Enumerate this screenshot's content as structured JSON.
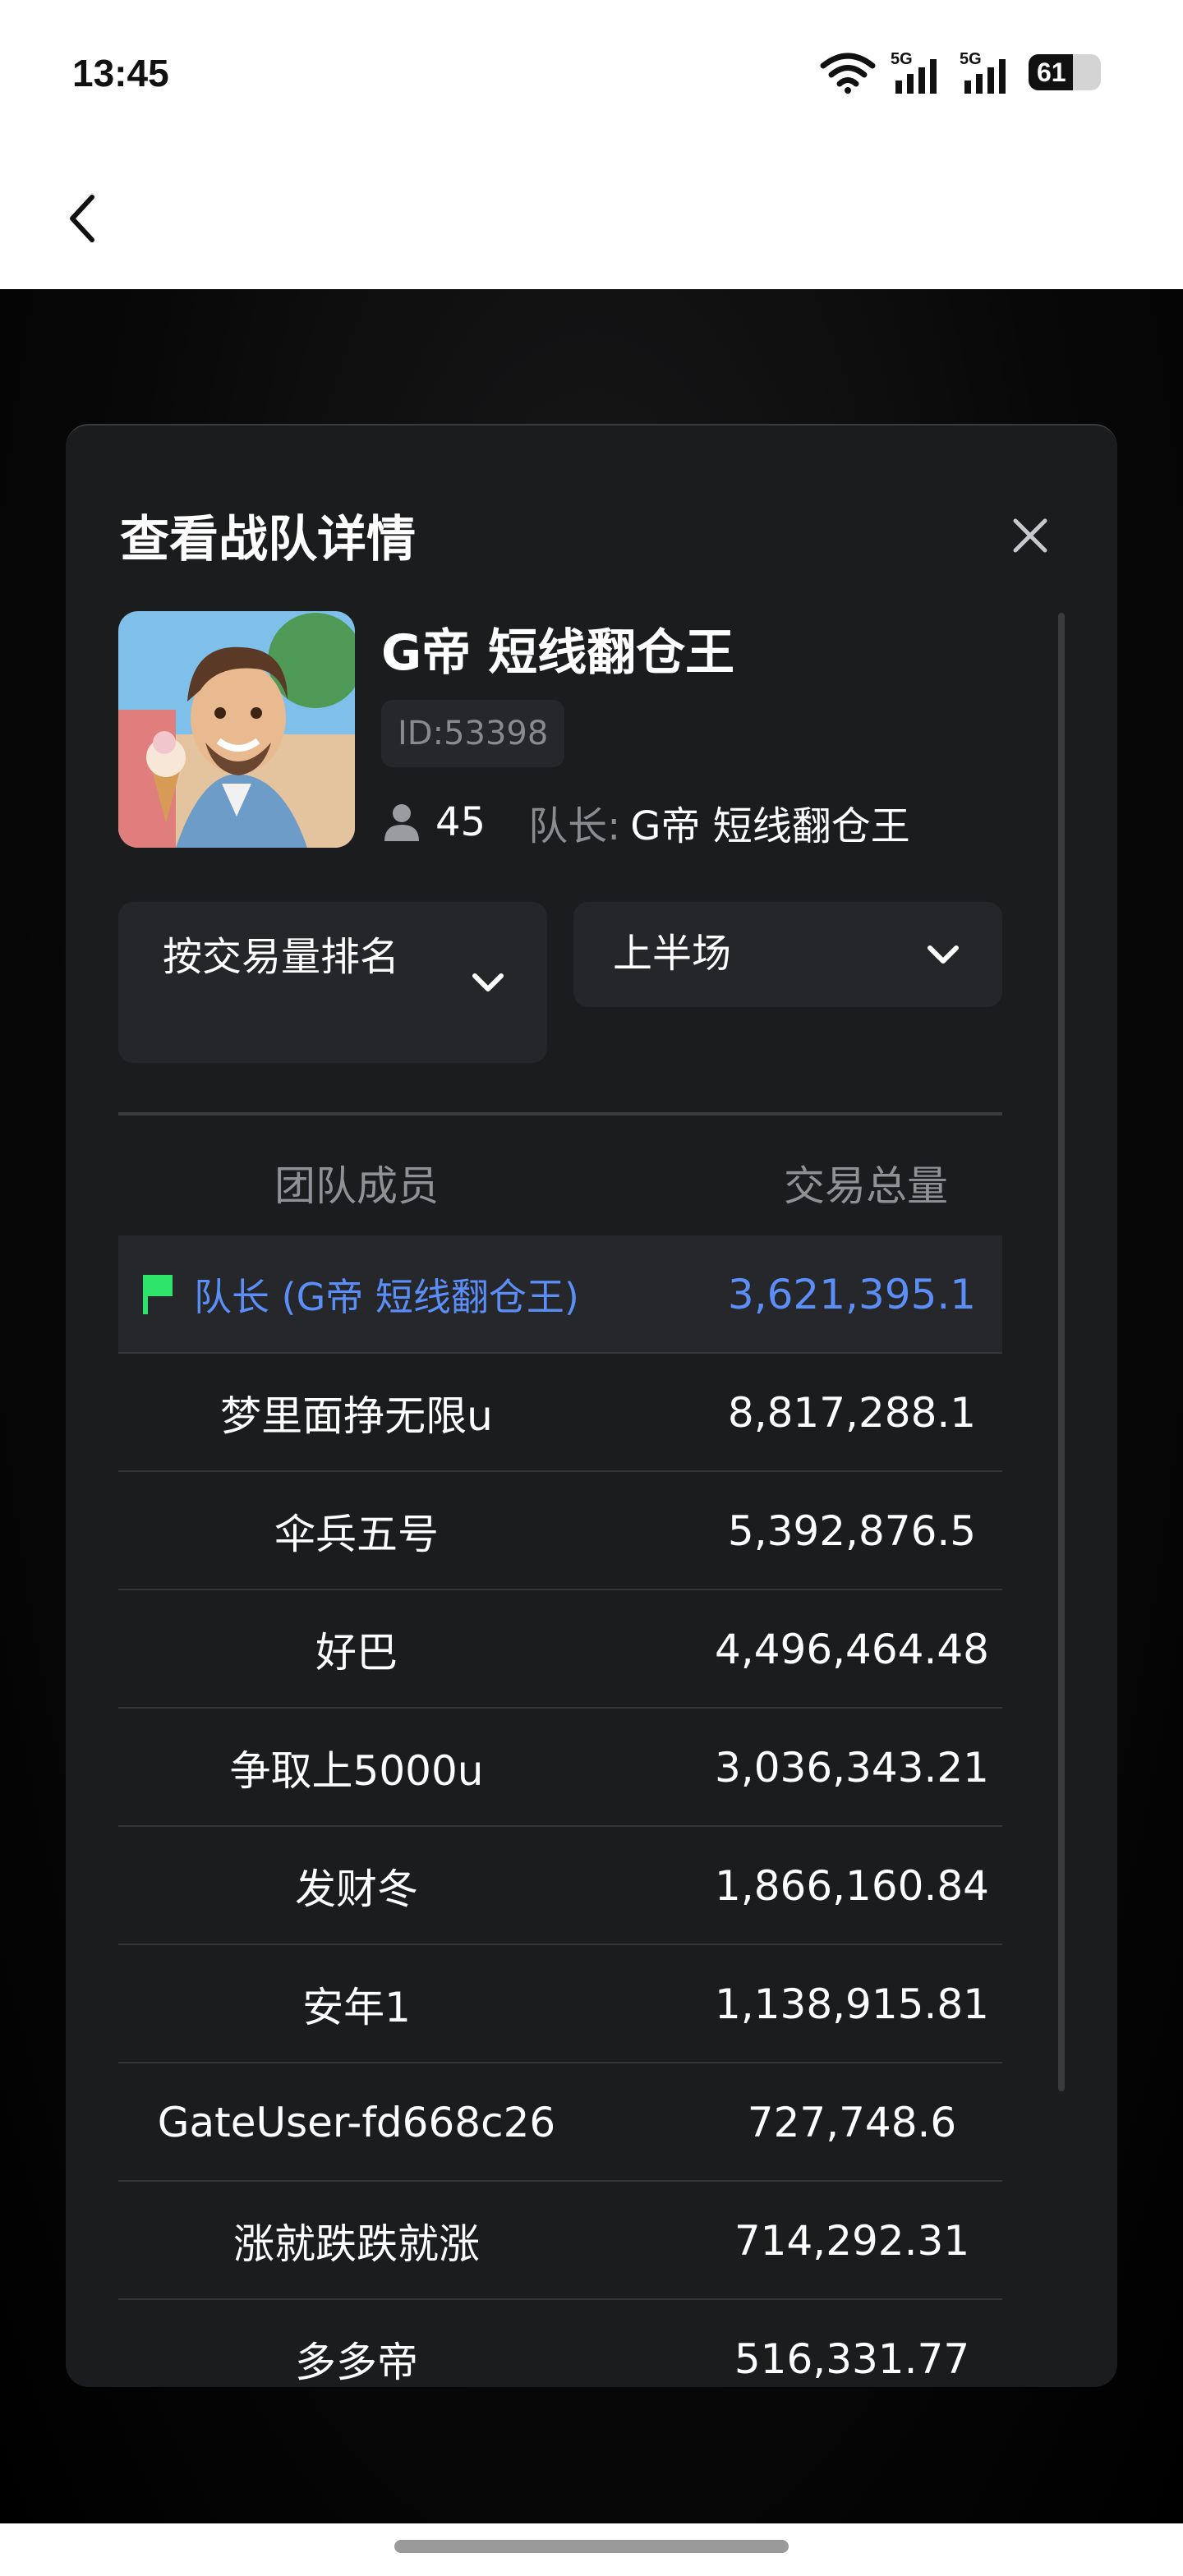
{
  "status_bar": {
    "time": "13:45",
    "battery": "61",
    "network": [
      "5G",
      "5G"
    ]
  },
  "modal": {
    "title": "查看战队详情",
    "team": {
      "name": "G帝 短线翻仓王",
      "id": "ID:53398",
      "member_count": "45",
      "captain_label": "队长:",
      "captain_name": "G帝 短线翻仓王"
    },
    "sort_dropdown": {
      "selected": "按交易量排名"
    },
    "half_dropdown": {
      "selected": "上半场"
    },
    "table": {
      "headers": [
        "团队成员",
        "交易总量"
      ],
      "rows": [
        {
          "name": "队长 (G帝 短线翻仓王)",
          "volume": "3,621,395.1",
          "leader": true
        },
        {
          "name": "梦里面挣无限u",
          "volume": "8,817,288.1"
        },
        {
          "name": "伞兵五号",
          "volume": "5,392,876.5"
        },
        {
          "name": "好巴",
          "volume": "4,496,464.48"
        },
        {
          "name": "争取上5000u",
          "volume": "3,036,343.21"
        },
        {
          "name": "发财冬",
          "volume": "1,866,160.84"
        },
        {
          "name": "安年1",
          "volume": "1,138,915.81"
        },
        {
          "name": "GateUser-fd668c26",
          "volume": "727,748.6"
        },
        {
          "name": "涨就跌跌就涨",
          "volume": "714,292.31"
        },
        {
          "name": "多多帝",
          "volume": "516,331.77"
        }
      ]
    }
  },
  "colors": {
    "modal_bg": "#1b1c1e",
    "accent_blue": "#5b8ef6",
    "flag_green": "#2ee36a"
  }
}
